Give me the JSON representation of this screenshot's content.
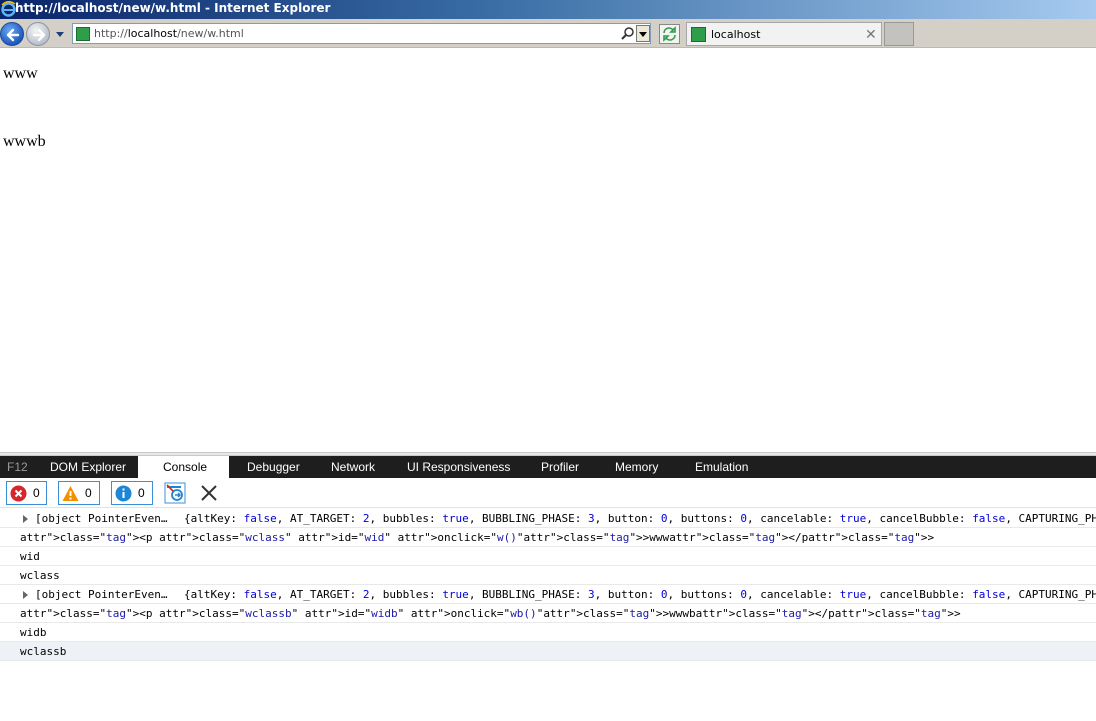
{
  "window": {
    "title": "http://localhost/new/w.html - Internet Explorer"
  },
  "address_bar": {
    "url_prefix": "http://",
    "url_host": "localhost",
    "url_path": "/new/w.html"
  },
  "tab": {
    "label": "localhost"
  },
  "page": {
    "p1": "www",
    "p2": "wwwb"
  },
  "devtools": {
    "tabs": [
      {
        "label": "F12"
      },
      {
        "label": "DOM Explorer"
      },
      {
        "label": "Console"
      },
      {
        "label": "Debugger"
      },
      {
        "label": "Network"
      },
      {
        "label": "UI Responsiveness"
      },
      {
        "label": "Profiler"
      },
      {
        "label": "Memory"
      },
      {
        "label": "Emulation"
      }
    ],
    "active_tab": "Console",
    "counters": {
      "errors": "0",
      "warnings": "0",
      "info": "0"
    },
    "console_rows": {
      "r1_obj": "[object PointerEven…",
      "r1_props": "{altKey: false, AT_TARGET: 2, bubbles: true, BUBBLING_PHASE: 3, button: 0, buttons: 0, cancelable: true, cancelBubble: false, CAPTURING_PHA",
      "r2_html": "<p class=\"wclass\" id=\"wid\" onclick=\"w()\">www</p>",
      "r3": "wid",
      "r4": "wclass",
      "r5_obj": "[object PointerEven…",
      "r5_props": "{altKey: false, AT_TARGET: 2, bubbles: true, BUBBLING_PHASE: 3, button: 0, buttons: 0, cancelable: true, cancelBubble: false, CAPTURING_PHA",
      "r6_html": "<p class=\"wclassb\" id=\"widb\" onclick=\"wb()\">wwwb</p>",
      "r7": "widb",
      "r8": "wclassb"
    }
  },
  "colors": {
    "titlebar_start": "#0a246a",
    "titlebar_end": "#a6caf0",
    "devtools_tabbar": "#1e1e1e",
    "counter_border": "#3c8fd6",
    "error_red": "#d9252a",
    "warning_orange": "#f29100",
    "info_blue": "#1e86d6"
  },
  "icons": [
    "ie-logo-icon",
    "back-arrow-icon",
    "forward-arrow-icon",
    "dropdown-arrow-icon",
    "favicon-icon",
    "search-icon",
    "refresh-icon",
    "tab-close-icon",
    "error-icon",
    "warning-icon",
    "info-icon",
    "clear-on-navigate-icon",
    "clear-console-icon",
    "expand-triangle-icon"
  ]
}
